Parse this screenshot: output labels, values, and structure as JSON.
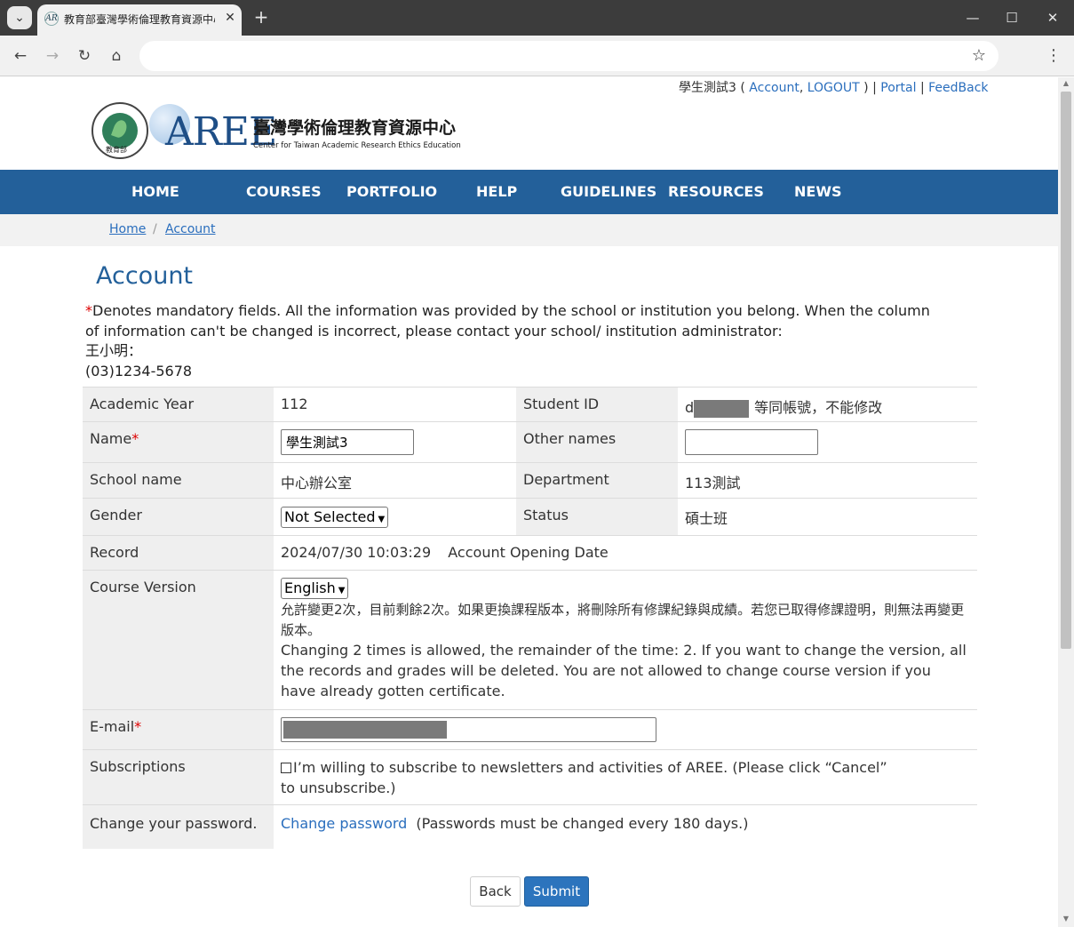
{
  "browser": {
    "tab_title": "教育部臺灣學術倫理教育資源中心",
    "tab_favicon": "AR",
    "address": "",
    "buttons": {
      "back": "←",
      "forward": "→",
      "reload": "↻",
      "home": "⌂",
      "star": "☆",
      "menu": "⋮",
      "tab_menu": "⌄",
      "new_tab": "+",
      "close": "✕",
      "minimize": "—",
      "maximize": "☐",
      "win_close": "✕"
    }
  },
  "userbar": {
    "username": "學生測試3",
    "open_paren": " ( ",
    "account": "Account",
    "comma": ", ",
    "logout": "LOGOUT",
    "close_paren": " ) | ",
    "portal": "Portal",
    "sep": " | ",
    "feedback": "FeedBack"
  },
  "logo": {
    "moe_text": "教育部",
    "moe_ring": "MINISTRY OF EDUCATION",
    "aree_letters": "AREE",
    "cn_name": "臺灣學術倫理教育資源中心",
    "en_name": "Center for Taiwan Academic Research Ethics Education"
  },
  "nav": [
    "HOME",
    "COURSES",
    "PORTFOLIO",
    "HELP",
    "GUIDELINES",
    "RESOURCES",
    "NEWS"
  ],
  "breadcrumb": {
    "home": "Home",
    "sep": "/",
    "current": "Account"
  },
  "page": {
    "title": "Account",
    "asterisk": "*",
    "notice": "Denotes mandatory fields. All the information was provided by the school or institution you belong. When the column of information can't be changed is incorrect, please contact your school/ institution administrator:",
    "contact_name": "王小明：",
    "contact_phone": "(03)1234-5678"
  },
  "form": {
    "academic_year_label": "Academic Year",
    "academic_year_value": "112",
    "student_id_label": "Student ID",
    "student_id_prefix": "d",
    "student_id_note": "等同帳號，不能修改",
    "name_label": "Name",
    "name_value": "學生測試3",
    "other_names_label": "Other names",
    "other_names_value": "",
    "school_label": "School name",
    "school_value": "中心辦公室",
    "department_label": "Department",
    "department_value": "113測試",
    "gender_label": "Gender",
    "gender_value": "Not Selected",
    "status_label": "Status",
    "status_value": "碩士班",
    "record_label": "Record",
    "record_datetime": "2024/07/30 10:03:29",
    "record_note": "Account Opening Date",
    "course_version_label": "Course Version",
    "course_version_value": "English",
    "course_version_note_cn": "允許變更2次，目前剩餘2次。如果更換課程版本，將刪除所有修課紀錄與成績。若您已取得修課證明，則無法再變更版本。",
    "course_version_note_en": "Changing 2 times is allowed, the remainder of the time: 2. If you want to change the version, all the records and grades will be deleted. You are not allowed to change course version if you have already gotten certificate.",
    "email_label": "E-mail",
    "subscriptions_label": "Subscriptions",
    "subscriptions_text": "I’m willing to subscribe to newsletters and activities of AREE. (Please click “Cancel” to unsubscribe.)",
    "subscriptions_checked": false,
    "password_label": "Change your password.",
    "password_link": "Change password",
    "password_note": "(Passwords must be changed every 180 days.)"
  },
  "actions": {
    "back": "Back",
    "submit": "Submit"
  },
  "colors": {
    "nav_bg": "#23609a",
    "link": "#2a6ebd",
    "submit_bg": "#2c74bd",
    "required": "#dd0000"
  }
}
